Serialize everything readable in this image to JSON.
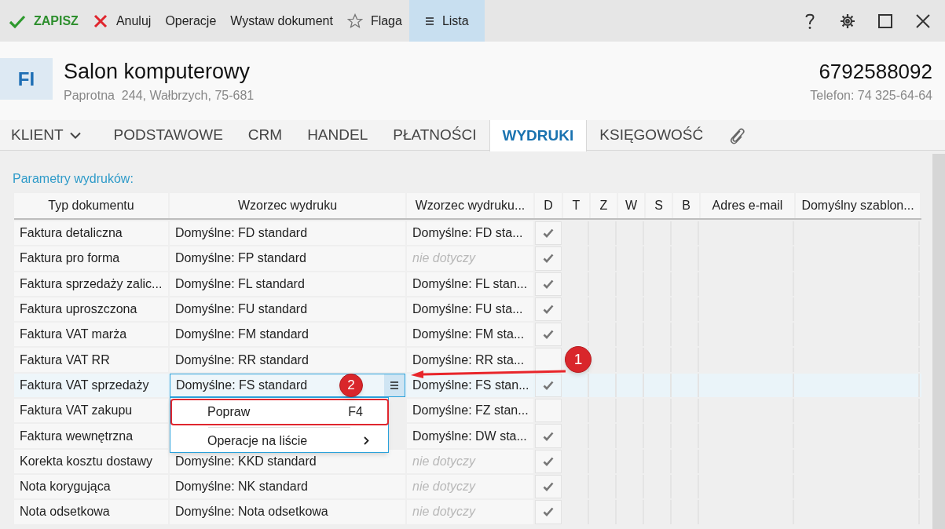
{
  "toolbar": {
    "items": [
      {
        "kind": "save",
        "label": "ZAPISZ",
        "selected": false
      },
      {
        "kind": "cancel",
        "label": "Anuluj",
        "selected": false
      },
      {
        "kind": "plain",
        "label": "Operacje",
        "selected": false
      },
      {
        "kind": "plain",
        "label": "Wystaw dokument",
        "selected": false
      },
      {
        "kind": "flag",
        "label": "Flaga",
        "selected": false
      },
      {
        "kind": "list",
        "label": "Lista",
        "selected": true
      }
    ]
  },
  "header": {
    "avatar": "FI",
    "name": "Salon komputerowy",
    "address": "Paprotna  244, Wałbrzych, 75-681",
    "nip": "6792588092",
    "phone": "Telefon: 74 325-64-64"
  },
  "tabs": [
    {
      "label": "KLIENT",
      "kind": "dropdown",
      "selected": false
    },
    {
      "label": "PODSTAWOWE",
      "kind": "text",
      "selected": false
    },
    {
      "label": "CRM",
      "kind": "text",
      "selected": false
    },
    {
      "label": "HANDEL",
      "kind": "text",
      "selected": false
    },
    {
      "label": "PŁATNOŚCI",
      "kind": "text",
      "selected": false
    },
    {
      "label": "WYDRUKI",
      "kind": "text",
      "selected": true
    },
    {
      "label": "KSIĘGOWOŚĆ",
      "kind": "text",
      "selected": false
    },
    {
      "kind": "attachment",
      "selected": false
    }
  ],
  "section_title": "Parametry wydruków:",
  "table": {
    "columns": [
      "Typ dokumentu",
      "Wzorzec wydruku",
      "Wzorzec wydruku...",
      "D",
      "T",
      "Z",
      "W",
      "S",
      "B",
      "Adres e-mail",
      "Domyślny szablon..."
    ],
    "rows": [
      {
        "type": "Faktura detaliczna",
        "template": "Domyślne: FD standard",
        "template2": "Domyślne: FD sta...",
        "template2_na": false,
        "d": true,
        "selected": false
      },
      {
        "type": "Faktura pro forma",
        "template": "Domyślne: FP standard",
        "template2": "nie dotyczy",
        "template2_na": true,
        "d": true,
        "selected": false
      },
      {
        "type": "Faktura sprzedaży zalic...",
        "template": "Domyślne: FL standard",
        "template2": "Domyślne: FL stan...",
        "template2_na": false,
        "d": true,
        "selected": false
      },
      {
        "type": "Faktura uproszczona",
        "template": "Domyślne: FU standard",
        "template2": "Domyślne: FU sta...",
        "template2_na": false,
        "d": true,
        "selected": false
      },
      {
        "type": "Faktura VAT marża",
        "template": "Domyślne: FM standard",
        "template2": "Domyślne: FM sta...",
        "template2_na": false,
        "d": true,
        "selected": false
      },
      {
        "type": "Faktura VAT RR",
        "template": "Domyślne: RR standard",
        "template2": "Domyślne: RR sta...",
        "template2_na": false,
        "d": false,
        "selected": false
      },
      {
        "type": "Faktura VAT sprzedaży",
        "template": "Domyślne: FS standard",
        "template2": "Domyślne: FS stan...",
        "template2_na": false,
        "d": true,
        "selected": true
      },
      {
        "type": "Faktura VAT zakupu",
        "template2": "Domyślne: FZ stan...",
        "template2_na": false,
        "d": false,
        "selected": false
      },
      {
        "type": "Faktura wewnętrzna",
        "template2": "Domyślne: DW sta...",
        "template2_na": false,
        "d": true,
        "selected": false
      },
      {
        "type": "Korekta kosztu dostawy",
        "template": "Domyślne: KKD standard",
        "template2": "nie dotyczy",
        "template2_na": true,
        "d": true,
        "selected": false
      },
      {
        "type": "Nota korygująca",
        "template": "Domyślne: NK standard",
        "template2": "nie dotyczy",
        "template2_na": true,
        "d": true,
        "selected": false
      },
      {
        "type": "Nota odsetkowa",
        "template": "Domyślne: Nota odsetkowa",
        "template2": "nie dotyczy",
        "template2_na": true,
        "d": true,
        "selected": false
      }
    ]
  },
  "context_menu": {
    "items": [
      {
        "label": "Popraw",
        "shortcut": "F4",
        "submenu": false
      },
      {
        "label": "Operacje na liście",
        "submenu": true
      }
    ]
  },
  "annotations": [
    {
      "label": "1"
    },
    {
      "label": "2"
    }
  ]
}
